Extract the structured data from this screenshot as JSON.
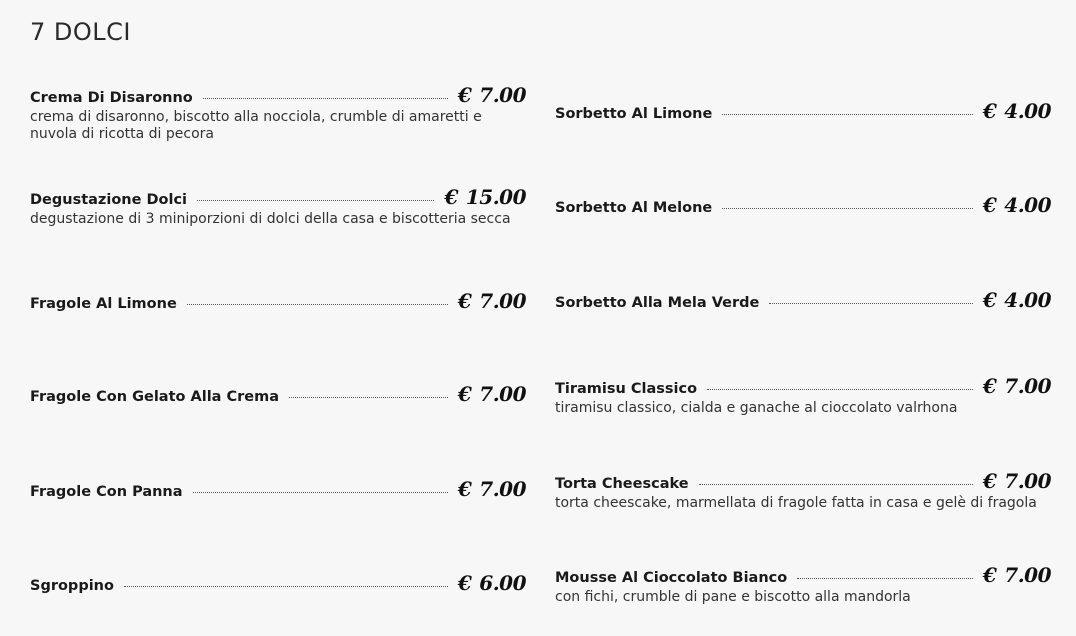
{
  "section": {
    "title": "7 DOLCI"
  },
  "currency": "€",
  "menu": {
    "left": [
      {
        "name": "Crema Di Disaronno",
        "price": "7.00",
        "description": "crema di disaronno, biscotto alla nocciola, crumble di amaretti e nuvola di ricotta di pecora"
      },
      {
        "name": "Degustazione Dolci",
        "price": "15.00",
        "description": "degustazione di 3 miniporzioni di dolci della casa e biscotteria secca"
      },
      {
        "name": "Fragole Al Limone",
        "price": "7.00",
        "description": ""
      },
      {
        "name": "Fragole Con Gelato Alla Crema",
        "price": "7.00",
        "description": ""
      },
      {
        "name": "Fragole Con Panna",
        "price": "7.00",
        "description": ""
      },
      {
        "name": "Sgroppino",
        "price": "6.00",
        "description": ""
      }
    ],
    "right": [
      {
        "name": "Sorbetto Al Limone",
        "price": "4.00",
        "description": ""
      },
      {
        "name": "Sorbetto Al Melone",
        "price": "4.00",
        "description": ""
      },
      {
        "name": "Sorbetto Alla Mela Verde",
        "price": "4.00",
        "description": ""
      },
      {
        "name": "Tiramisu Classico",
        "price": "7.00",
        "description": "tiramisu classico, cialda e ganache al cioccolato valrhona"
      },
      {
        "name": "Torta Cheescake",
        "price": "7.00",
        "description": "torta cheescake, marmellata di fragole fatta in casa e gelè di fragola"
      },
      {
        "name": "Mousse Al Cioccolato Bianco",
        "price": "7.00",
        "description": "con fichi, crumble di pane e biscotto alla mandorla"
      }
    ]
  }
}
